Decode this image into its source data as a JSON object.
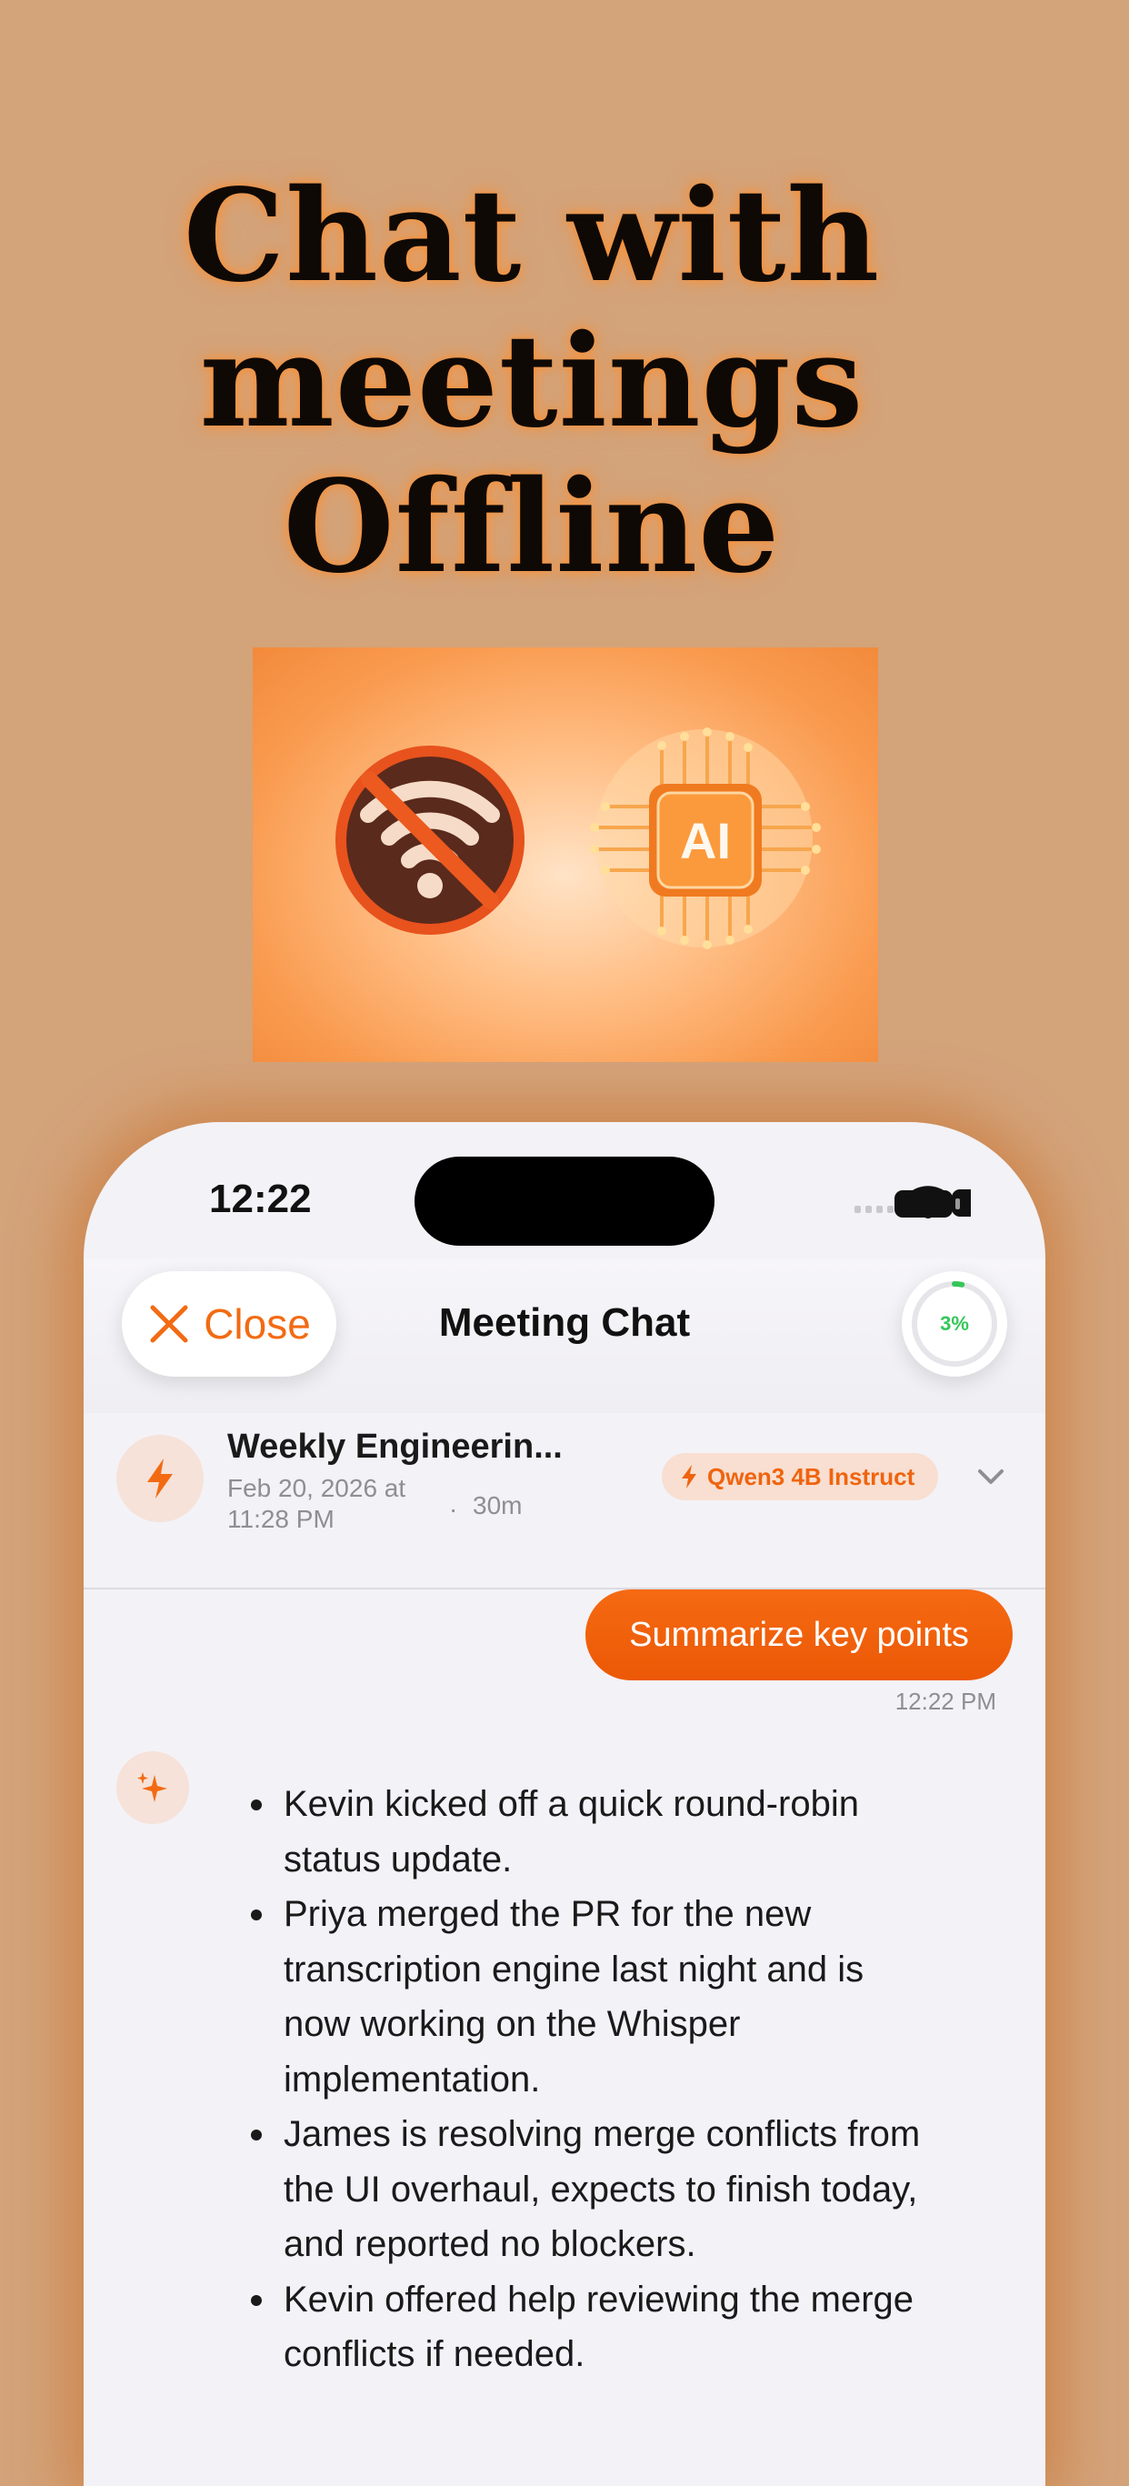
{
  "headline": {
    "line1": "Chat with",
    "line2": "meetings",
    "line3": "Offline"
  },
  "hero": {
    "left_icon": "no-wifi-icon",
    "right_icon": "ai-chip-icon",
    "chip_label": "AI"
  },
  "status_bar": {
    "time": "12:22",
    "icons": [
      "cellular-icon",
      "wifi-icon",
      "battery-icon"
    ]
  },
  "nav": {
    "close_label": "Close",
    "title": "Meeting Chat",
    "progress_label": "3%",
    "progress_value": 0.03,
    "progress_color": "#34c759"
  },
  "meeting": {
    "title": "Weekly Engineerin...",
    "date": "Feb 20, 2026 at 11:28 PM",
    "separator": "·",
    "duration": "30m",
    "model": "Qwen3 4B Instruct"
  },
  "chat": {
    "user_message": "Summarize key points",
    "user_time": "12:22 PM",
    "ai_points": [
      "Kevin kicked off a quick round-robin status update.",
      "Priya merged the PR for the new transcription engine last night and is now working on the Whisper implementation.",
      "James is resolving merge conflicts from the UI overhaul, expects to finish today, and reported no blockers.",
      "Kevin offered help reviewing the merge conflicts if needed."
    ]
  },
  "colors": {
    "background": "#d3a37a",
    "accent": "#f26b13",
    "phone_bg": "#f3f2f7"
  }
}
